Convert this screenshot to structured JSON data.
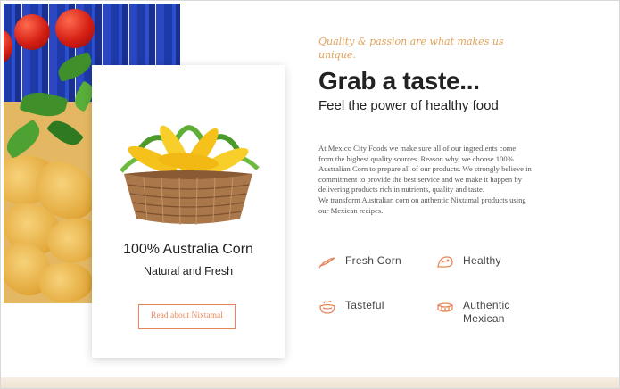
{
  "card": {
    "title": "100% Australia Corn",
    "subtitle": "Natural and Fresh",
    "button_label": "Read about Nixtamal"
  },
  "content": {
    "tagline": "Quality & passion are what makes us unique.",
    "headline": "Grab a taste...",
    "subheadline": "Feel the power of healthy food",
    "paragraph": "At Mexico City Foods we make sure all of our ingredients come from the highest quality sources. Reason why, we choose 100% Australian Corn to prepare all of our products. We strongly believe in commitment to provide the best service and we make it happen by delivering products rich in nutrients, quality and taste.",
    "paragraph2": "We transform Australian corn on authentic Nixtamal products using our Mexican recipes."
  },
  "features": [
    {
      "label": "Fresh Corn",
      "icon": "corn-icon"
    },
    {
      "label": "Healthy",
      "icon": "taco-icon"
    },
    {
      "label": "Tasteful",
      "icon": "bowl-icon"
    },
    {
      "label": "Authentic Mexican",
      "icon": "burrito-icon"
    }
  ],
  "colors": {
    "accent": "#e8865a",
    "tagline": "#e0a25a",
    "heading": "#222222"
  }
}
